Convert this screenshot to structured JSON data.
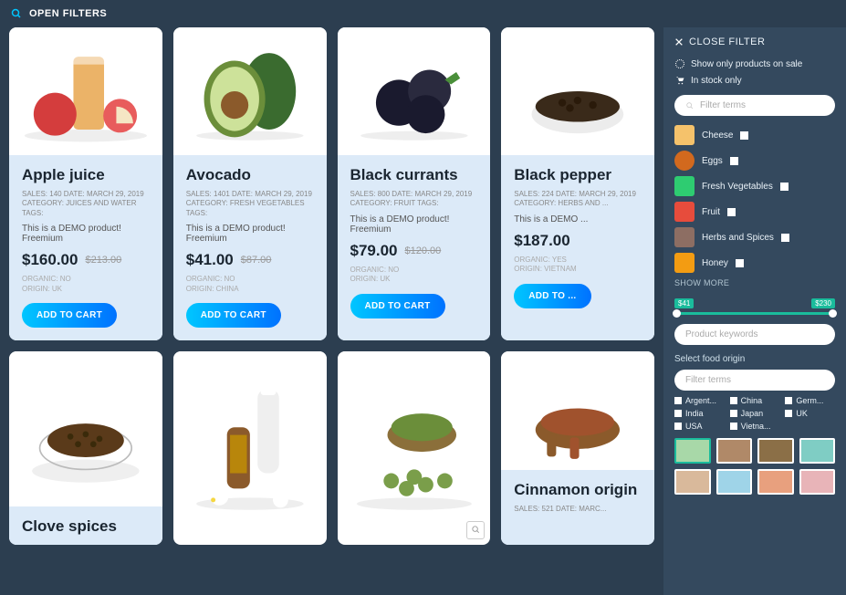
{
  "topbar": {
    "open_filters": "OPEN FILTERS"
  },
  "products": [
    {
      "title": "Apple juice",
      "meta": "SALES: 140 DATE: MARCH 29, 2019 CATEGORY: JUICES AND WATER TAGS:",
      "desc": "This is a DEMO product! Freemium",
      "price": "$160.00",
      "old": "$213.00",
      "origin": "ORGANIC: NO\nORIGIN: UK",
      "btn": "ADD TO CART"
    },
    {
      "title": "Avocado",
      "meta": "SALES: 1401 DATE: MARCH 29, 2019 CATEGORY: FRESH VEGETABLES TAGS:",
      "desc": "This is a DEMO product! Freemium",
      "price": "$41.00",
      "old": "$87.00",
      "origin": "ORGANIC: NO\nORIGIN: CHINA",
      "btn": "ADD TO CART"
    },
    {
      "title": "Black currants",
      "meta": "SALES: 800 DATE: MARCH 29, 2019 CATEGORY: FRUIT TAGS:",
      "desc": "This is a DEMO product! Freemium",
      "price": "$79.00",
      "old": "$120.00",
      "origin": "ORGANIC: NO\nORIGIN: UK",
      "btn": "ADD TO CART"
    },
    {
      "title": "Black pepper",
      "meta": "SALES: 224 DATE: MARCH 29, 2019 CATEGORY: HERBS AND ...",
      "desc": "This is a DEMO ...",
      "price": "$187.00",
      "old": "",
      "origin": "ORGANIC: YES\nORIGIN: VIETNAM",
      "btn": "ADD TO ..."
    },
    {
      "title": "Clove spices"
    },
    {
      "title": ""
    },
    {
      "title": ""
    },
    {
      "title": "Cinnamon origin",
      "meta": "SALES: 521 DATE: MARC..."
    }
  ],
  "sidebar": {
    "close": "CLOSE FILTER",
    "sale": "Show only products on sale",
    "stock": "In stock only",
    "filter_terms": "Filter terms",
    "categories": [
      {
        "label": "Cheese",
        "color": "#f5c26b"
      },
      {
        "label": "Eggs",
        "color": "#d2691e"
      },
      {
        "label": "Fresh Vegetables",
        "color": "#2ecc71"
      },
      {
        "label": "Fruit",
        "color": "#e74c3c"
      },
      {
        "label": "Herbs and Spices",
        "color": "#8d6e63"
      },
      {
        "label": "Honey",
        "color": "#f39c12"
      }
    ],
    "show_more": "SHOW MORE",
    "range_min": "$41",
    "range_max": "$230",
    "keywords": "Product keywords",
    "origin_label": "Select food origin",
    "filter_terms2": "Filter terms",
    "origins": [
      "Argent...",
      "China",
      "Germ...",
      "India",
      "Japan",
      "UK",
      "USA",
      "Vietna..."
    ],
    "swatches": [
      "#a8d8a8",
      "#b08968",
      "#8b6f47",
      "#7fcdc4",
      "#d9b99b",
      "#9fd4e8",
      "#e8a07e",
      "#e8b4b8"
    ]
  }
}
